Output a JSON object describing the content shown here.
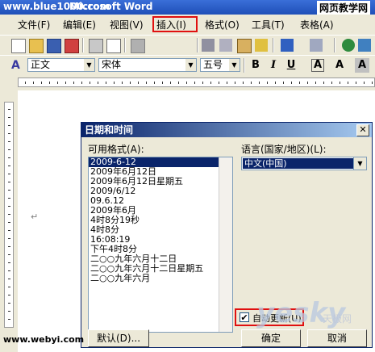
{
  "window": {
    "title": "Microsoft Word",
    "watermark_left": "www.blue1000.com",
    "watermark_right": "网页教学网"
  },
  "menu": [
    "文件(F)",
    "编辑(E)",
    "视图(V)",
    "插入(I)",
    "格式(O)",
    "工具(T)",
    "表格(A)"
  ],
  "toolbar2": {
    "style": "正文",
    "font": "宋体",
    "size": "五号",
    "bold": "B",
    "italic": "I",
    "underline": "U",
    "font_color": "A"
  },
  "dialog": {
    "title": "日期和时间",
    "formats_label": "可用格式(A):",
    "formats": [
      "2009-6-12",
      "2009年6月12日",
      "2009年6月12日星期五",
      "2009/6/12",
      "09.6.12",
      "2009年6月",
      "4时8分19秒",
      "4时8分",
      "16:08:19",
      "下午4时8分",
      "二○○九年六月十二日",
      "二○○九年六月十二日星期五",
      "二○○九年六月"
    ],
    "selected_index": 0,
    "language_label": "语言(国家/地区)(L):",
    "language_value": "中文(中国)",
    "auto_update_label": "自动更新(U)",
    "auto_update_checked": true,
    "default_button": "默认(D)...",
    "ok_button": "确定",
    "cancel_button": "取消"
  },
  "watermarks": {
    "bottom_left": "www.webyi.com",
    "brand": "yesky",
    "brand_cn": "天极网"
  },
  "colors": {
    "highlight": "#e01010",
    "selection": "#0a246a",
    "chrome": "#ece9d8"
  }
}
